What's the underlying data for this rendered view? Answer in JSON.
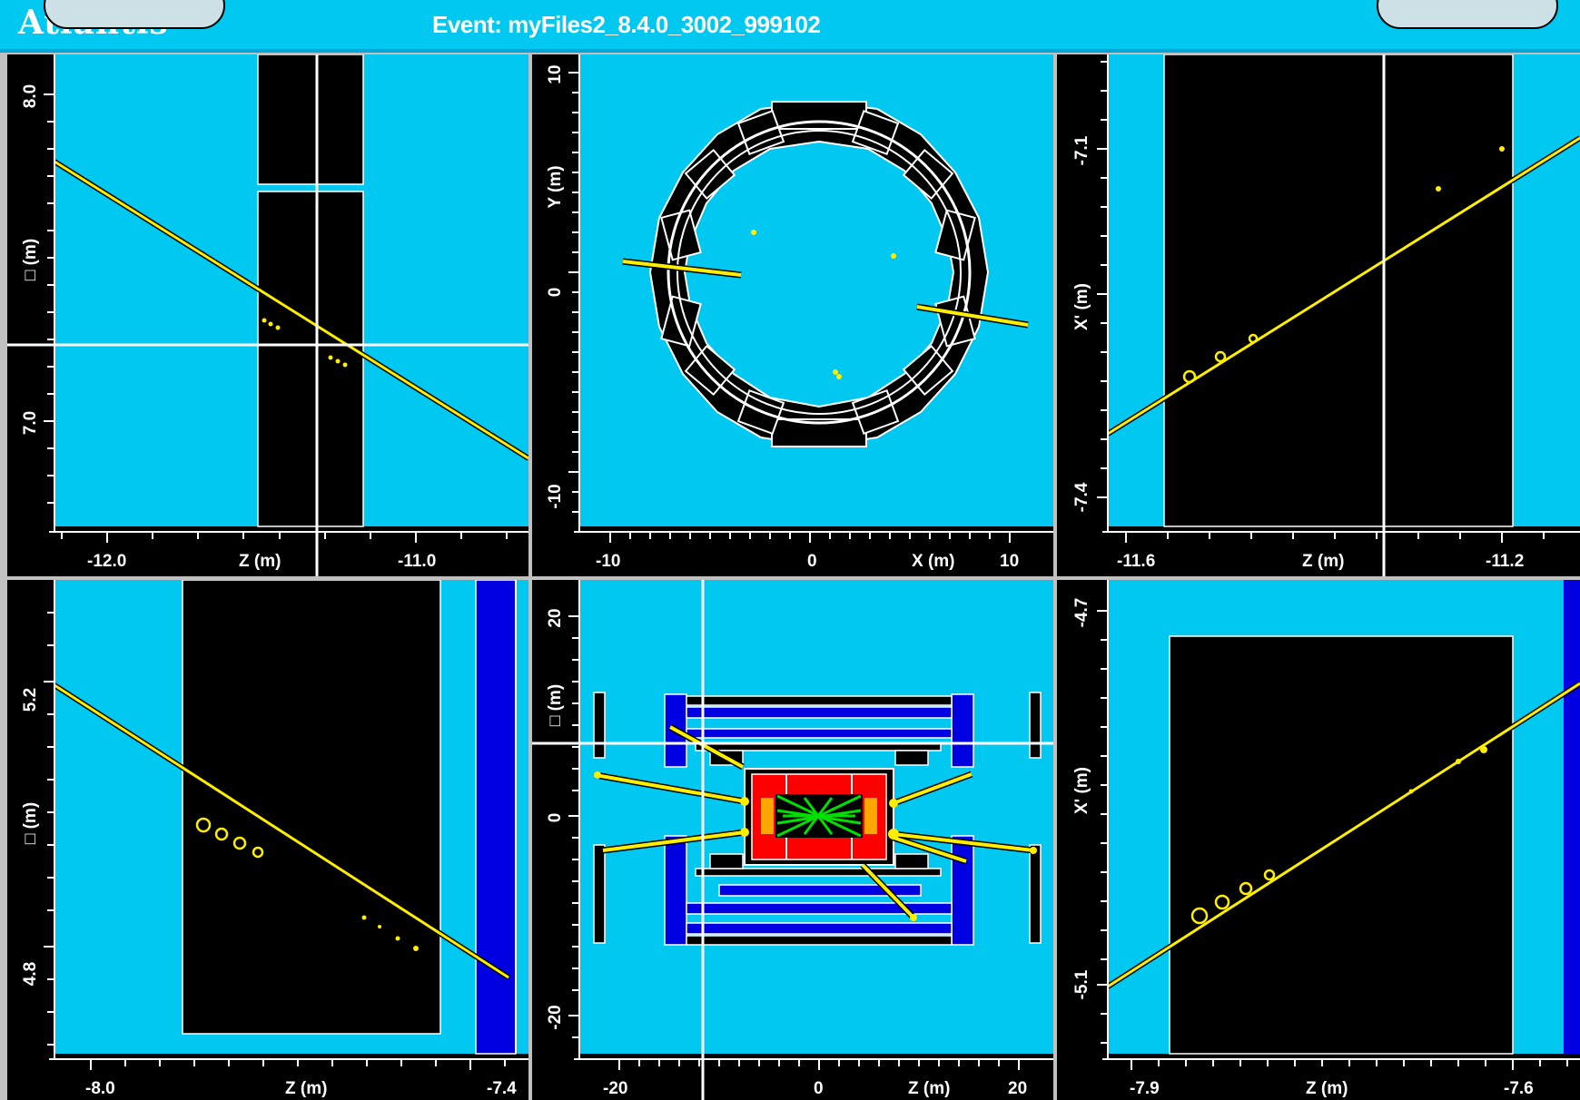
{
  "app": {
    "name": "Atlantis"
  },
  "event": {
    "label": "Event: myFiles2_8.4.0_3002_999102"
  },
  "colors": {
    "background": "#00c8f0",
    "detector": "#000000",
    "track": "#ffee00",
    "muon_chamber": "#0000e0",
    "calorimeter": "#ff0000",
    "inner_tracks": "#00e000"
  },
  "panels": {
    "top_left": {
      "x_axis": {
        "label": "Z (m)",
        "ticks": [
          "-12.0",
          "-11.0"
        ]
      },
      "y_axis": {
        "label": "□ (m)",
        "ticks": [
          "8.0",
          "7.0"
        ]
      }
    },
    "top_center": {
      "x_axis": {
        "label": "X (m)",
        "ticks": [
          "-10",
          "0",
          "10"
        ]
      },
      "y_axis": {
        "label": "Y (m)",
        "ticks": [
          "10",
          "0",
          "-10"
        ]
      }
    },
    "top_right": {
      "x_axis": {
        "label": "Z (m)",
        "ticks": [
          "-11.6",
          "-11.2"
        ]
      },
      "y_axis": {
        "label": "X' (m)",
        "ticks": [
          "-7.1",
          "-7.4"
        ]
      }
    },
    "bottom_left": {
      "x_axis": {
        "label": "Z (m)",
        "ticks": [
          "-8.0",
          "-7.4"
        ]
      },
      "y_axis": {
        "label": "□ (m)",
        "ticks": [
          "5.2",
          "4.8"
        ]
      }
    },
    "bottom_center": {
      "x_axis": {
        "label": "Z (m)",
        "ticks": [
          "-20",
          "0",
          "20"
        ]
      },
      "y_axis": {
        "label": "□ (m)",
        "ticks": [
          "20",
          "0",
          "-20"
        ]
      }
    },
    "bottom_right": {
      "x_axis": {
        "label": "Z (m)",
        "ticks": [
          "-7.9",
          "-7.6"
        ]
      },
      "y_axis": {
        "label": "X' (m)",
        "ticks": [
          "-4.7",
          "-5.1"
        ]
      }
    }
  }
}
